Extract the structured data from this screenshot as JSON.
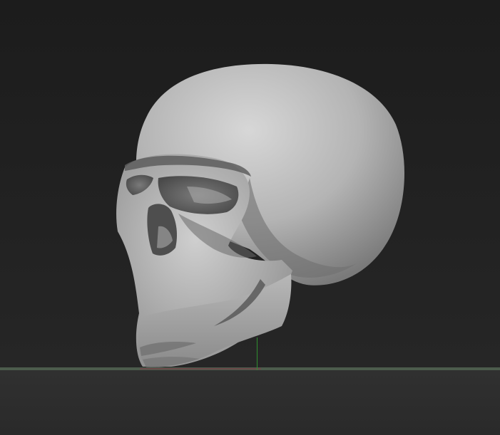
{
  "app": {
    "name": "",
    "view": "3d-viewport"
  },
  "scene": {
    "model": "skull-sculpt",
    "floor_grid": true,
    "axis_colors": {
      "y_axis": "#2f8f2f",
      "x_axis": "#6a4848",
      "floor_line": "#4c5c4c"
    },
    "material_color": "#bdbdbd",
    "background_color": "#1e1e1e"
  }
}
